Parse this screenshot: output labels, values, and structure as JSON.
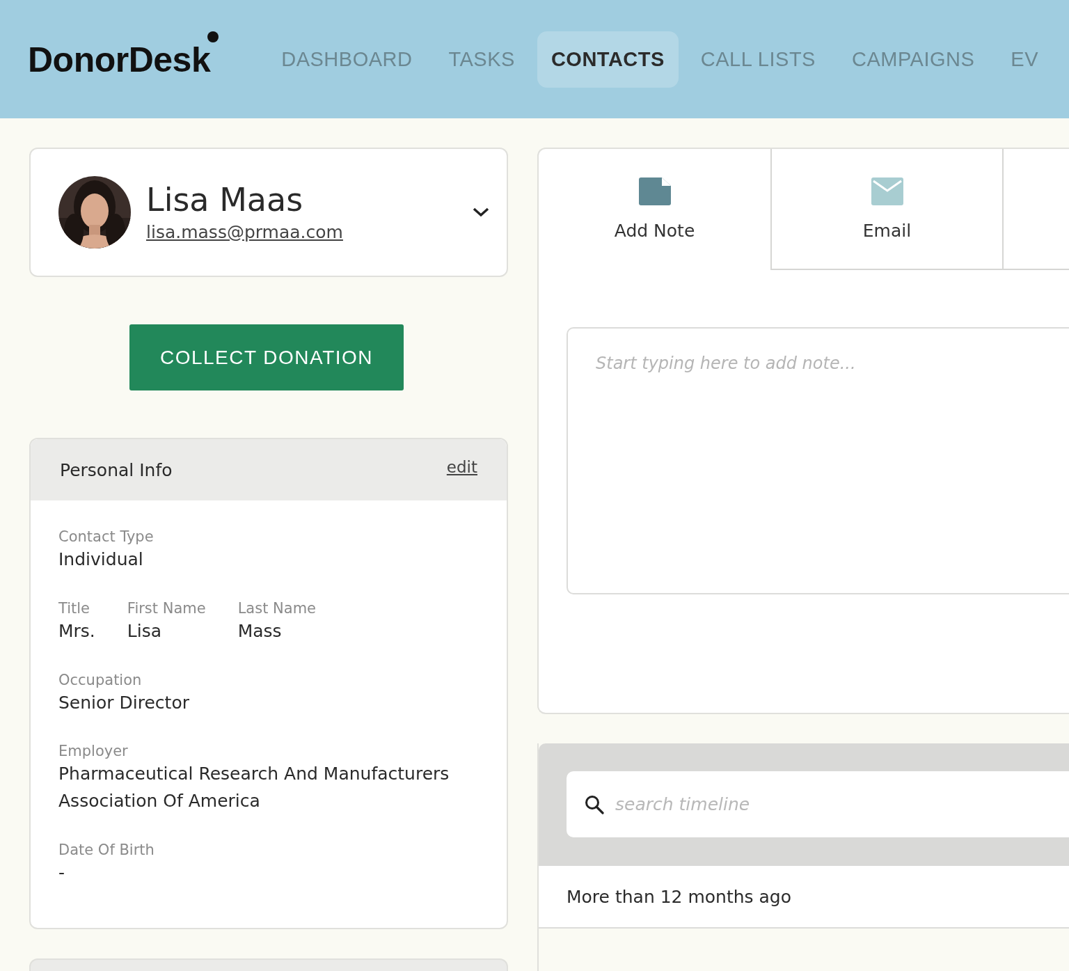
{
  "header": {
    "logo": "DonorDesk",
    "nav": [
      {
        "label": "DASHBOARD",
        "selected": false
      },
      {
        "label": "TASKS",
        "selected": false
      },
      {
        "label": "CONTACTS",
        "selected": true
      },
      {
        "label": "CALL LISTS",
        "selected": false
      },
      {
        "label": "CAMPAIGNS",
        "selected": false
      },
      {
        "label": "EV",
        "selected": false
      }
    ]
  },
  "contact": {
    "name": "Lisa Maas",
    "email": "lisa.mass@prmaa.com"
  },
  "donate_button": "COLLECT DONATION",
  "personal_info": {
    "title": "Personal Info",
    "edit_link": "edit",
    "rows": [
      [
        {
          "label": "Contact Type",
          "value": "Individual"
        }
      ],
      [
        {
          "label": "Title",
          "value": "Mrs."
        },
        {
          "label": "First Name",
          "value": "Lisa"
        },
        {
          "label": "Last Name",
          "value": "Mass"
        }
      ],
      [
        {
          "label": "Occupation",
          "value": "Senior Director"
        }
      ],
      [
        {
          "label": "Employer",
          "value": "Pharmaceutical Research And Manufacturers Association Of America"
        }
      ],
      [
        {
          "label": "Date Of Birth",
          "value": "-"
        }
      ]
    ]
  },
  "actions": {
    "tabs": [
      {
        "label": "Add Note",
        "kind": "note",
        "selected": true
      },
      {
        "label": "Email",
        "kind": "email",
        "selected": false
      }
    ],
    "note_field": {
      "placeholder": "Start typing here to add note..."
    }
  },
  "timeline": {
    "search": {
      "placeholder": "search timeline"
    },
    "group": "More than 12 months ago"
  }
}
